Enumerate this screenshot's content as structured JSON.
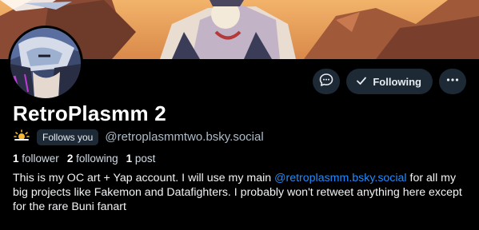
{
  "profile": {
    "display_name": "RetroPlasmm 2",
    "weather_icon": "sun-cloud-icon",
    "follows_you": "Follows you",
    "handle": "@retroplasmmtwo.bsky.social",
    "stats": {
      "followers_count": "1",
      "followers_label": "follower",
      "following_count": "2",
      "following_label": "following",
      "posts_count": "1",
      "posts_label": "post"
    },
    "bio": {
      "part1": "This is my OC art + Yap account. I will use my main ",
      "mention": "@retroplasmm.bsky.social",
      "part2": " for all my big projects like Fakemon and Datafighters. I probably won't retweet anything here except for the rare Buni fanart"
    }
  },
  "actions": {
    "message_icon": "chat-bubble-icon",
    "following_label": "Following",
    "following_icon": "checkmark-icon",
    "more_icon": "ellipsis-icon"
  },
  "colors": {
    "background": "#000000",
    "button_bg": "#1e2936",
    "link": "#208bfe",
    "muted_text": "#aebbc9"
  }
}
